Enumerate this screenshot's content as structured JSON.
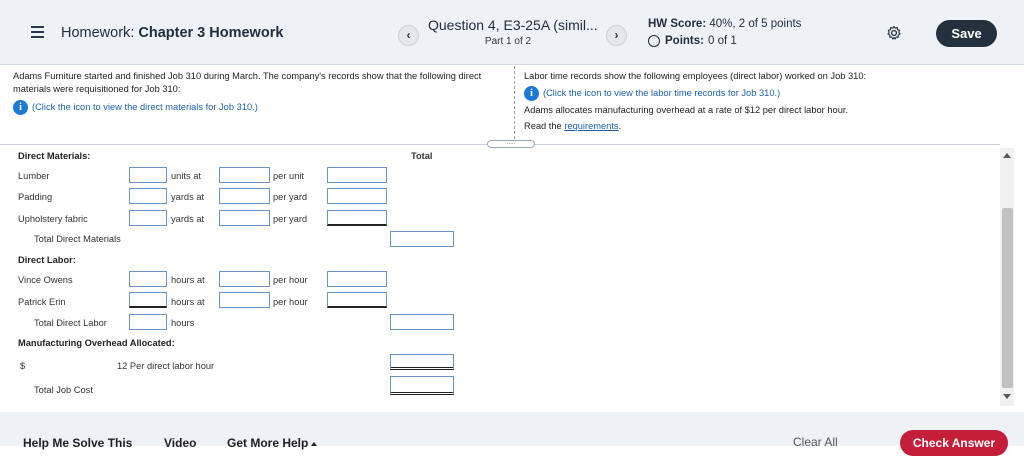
{
  "header": {
    "menu_icon": "hamburger-menu-icon",
    "hw_prefix": "Homework:",
    "hw_name": "Chapter 3 Homework",
    "prev_label": "‹",
    "next_label": "›",
    "question_title": "Question 4, E3-25A (simil...",
    "question_part": "Part 1 of 2",
    "hw_score_label": "HW Score:",
    "hw_score_value": "40%, 2 of 5 points",
    "points_label": "Points:",
    "points_value": "0 of 1",
    "save_label": "Save",
    "settings_icon": "gear-icon"
  },
  "question": {
    "left_text": "Adams Furniture started and finished Job 310 during March. The company's records show that the following direct materials were requisitioned for Job 310:",
    "left_link": "(Click the icon to view the direct materials for Job 310.)",
    "right_text": "Labor time records show the following employees (direct labor) worked on Job 310:",
    "right_link": "(Click the icon to view the labor time records for Job 310.)",
    "right_rate": "Adams allocates manufacturing overhead at a rate of $12 per direct labor hour.",
    "read_prefix": "Read the",
    "requirements_link": "requirements",
    "read_suffix": ".",
    "splitter_label": "....."
  },
  "worksheet": {
    "total_header": "Total",
    "direct_materials": "Direct Materials:",
    "lumber": "Lumber",
    "padding": "Padding",
    "upholstery": "Upholstery fabric",
    "units_at": "units at",
    "yards_at": "yards at",
    "per_unit": "per unit",
    "per_yard": "per yard",
    "total_dm": "Total Direct Materials",
    "direct_labor": "Direct Labor:",
    "vince": "Vince Owens",
    "patrick": "Patrick Erin",
    "hours_at": "hours at",
    "per_hour": "per hour",
    "total_dl": "Total Direct Labor",
    "hours": "hours",
    "moh": "Manufacturing Overhead Allocated:",
    "dollar": "$",
    "rate_text": "12 Per direct labor hour",
    "total_job_cost": "Total Job Cost"
  },
  "footer": {
    "help_solve": "Help Me Solve This",
    "video": "Video",
    "more_help": "Get More Help",
    "clear_all": "Clear All",
    "check_answer": "Check Answer"
  }
}
